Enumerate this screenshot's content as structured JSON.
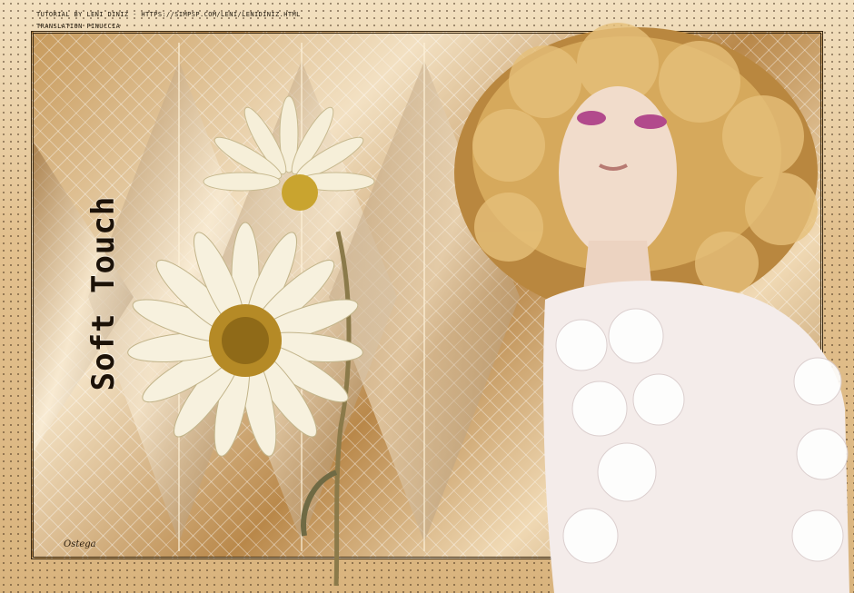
{
  "credits": {
    "line1": "TUTORIAL BY LENI DINIZ - HTTPS://SIMPSP.COM/LENI/LENIDINIZ.HTML",
    "line2": "TRANSLATION PINUCCIA"
  },
  "title": "Soft Touch",
  "signature": "Ostega",
  "colors": {
    "gold": "#c79a5c",
    "cream": "#f3e1c3",
    "dark": "#1c1208"
  }
}
